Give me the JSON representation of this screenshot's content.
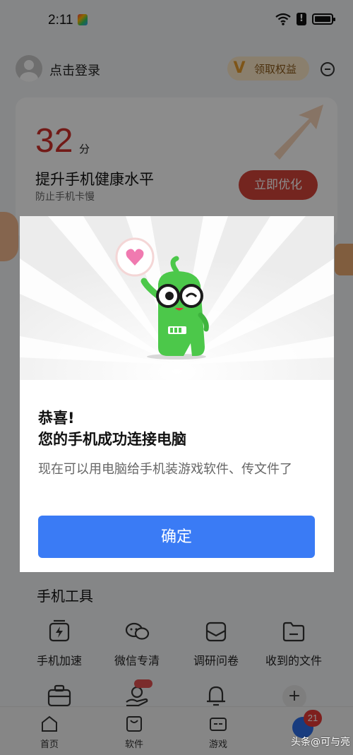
{
  "status_bar": {
    "time": "2:11",
    "alert_glyph": "!"
  },
  "header": {
    "login_text": "点击登录",
    "vip_logo": "V",
    "vip_label": "领取权益"
  },
  "score_card": {
    "score": "32",
    "score_unit": "分",
    "title": "提升手机健康水平",
    "subtitle": "防止手机卡慢",
    "optimize_button": "立即优化"
  },
  "tools": {
    "title": "手机工具",
    "items": [
      {
        "label": "手机加速",
        "icon": "speed-box-icon"
      },
      {
        "label": "微信专清",
        "icon": "chat-bubbles-icon"
      },
      {
        "label": "调研问卷",
        "icon": "envelope-icon"
      },
      {
        "label": "收到的文件",
        "icon": "folder-icon"
      }
    ],
    "row2_icons": [
      "toolbox-icon",
      "hand-coin-icon",
      "bell-icon"
    ],
    "plus_label": "+"
  },
  "bottom_nav": {
    "items": [
      {
        "label": "首页",
        "icon": "home-icon"
      },
      {
        "label": "软件",
        "icon": "bag-icon"
      },
      {
        "label": "游戏",
        "icon": "gamepad-icon"
      }
    ],
    "badge": "21"
  },
  "dialog": {
    "title_line1": "恭喜!",
    "title_line2": "您的手机成功连接电脑",
    "message": "现在可以用电脑给手机装游戏软件、传文件了",
    "confirm_button": "确定"
  },
  "watermark": "头条@可与亮",
  "colors": {
    "accent_blue": "#3a7bf5",
    "score_red": "#d0302a",
    "optimize_red": "#d4443a",
    "mascot_green": "#4cc84a",
    "badge_red": "#e53935"
  }
}
